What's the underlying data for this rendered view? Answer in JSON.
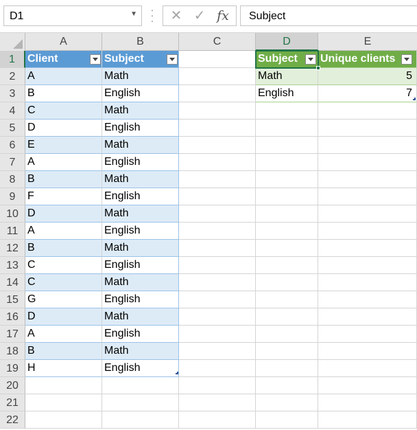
{
  "formula_bar": {
    "name_box": "D1",
    "formula": "Subject",
    "fx_label": "fx"
  },
  "columns": [
    "A",
    "B",
    "C",
    "D",
    "E"
  ],
  "selected_column": "D",
  "selected_row": 1,
  "row_numbers": [
    "1",
    "2",
    "3",
    "4",
    "5",
    "6",
    "7",
    "8",
    "9",
    "10",
    "11",
    "12",
    "13",
    "14",
    "15",
    "16",
    "17",
    "18",
    "19",
    "20",
    "21",
    "22"
  ],
  "table1": {
    "headers": [
      "Client",
      "Subject"
    ],
    "rows": [
      [
        "A",
        "Math"
      ],
      [
        "B",
        "English"
      ],
      [
        "C",
        "Math"
      ],
      [
        "D",
        "English"
      ],
      [
        "E",
        "Math"
      ],
      [
        "A",
        "English"
      ],
      [
        "B",
        "Math"
      ],
      [
        "F",
        "English"
      ],
      [
        "D",
        "Math"
      ],
      [
        "A",
        "English"
      ],
      [
        "B",
        "Math"
      ],
      [
        "C",
        "English"
      ],
      [
        "C",
        "Math"
      ],
      [
        "G",
        "English"
      ],
      [
        "D",
        "Math"
      ],
      [
        "A",
        "English"
      ],
      [
        "B",
        "Math"
      ],
      [
        "H",
        "English"
      ]
    ]
  },
  "table2": {
    "headers": [
      "Subject",
      "Unique clients"
    ],
    "rows": [
      [
        "Math",
        "5"
      ],
      [
        "English",
        "7"
      ]
    ]
  },
  "colors": {
    "table1_header": "#5b9bd5",
    "table1_band": "#ddebf7",
    "table2_header": "#70ad47",
    "table2_band": "#e2efda",
    "selection": "#217346"
  },
  "icons": {
    "cancel": "close-icon",
    "enter": "check-icon",
    "function": "fx-icon",
    "name_box_dropdown": "chevron-down-icon"
  }
}
